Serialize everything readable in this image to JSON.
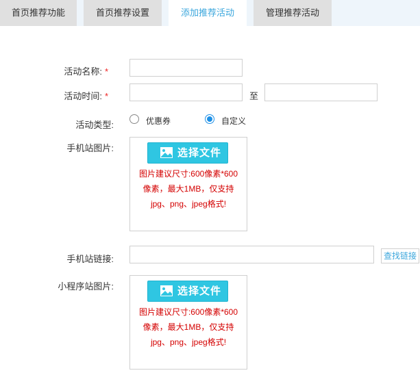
{
  "tabs": [
    {
      "label": "首页推荐功能",
      "active": false
    },
    {
      "label": "首页推荐设置",
      "active": false
    },
    {
      "label": "添加推荐活动",
      "active": true
    },
    {
      "label": "管理推荐活动",
      "active": false
    }
  ],
  "form": {
    "name": {
      "label": "活动名称:",
      "required": "*",
      "value": ""
    },
    "time": {
      "label": "活动时间:",
      "required": "*",
      "start_value": "",
      "separator": "至",
      "end_value": ""
    },
    "type": {
      "label": "活动类型:",
      "options": [
        {
          "label": "优惠券",
          "checked": false
        },
        {
          "label": "自定义",
          "checked": true
        }
      ]
    },
    "mobile_image": {
      "label": "手机站图片:",
      "button": "选择文件",
      "hint_lines": [
        "图片建议尺寸:600像素*600",
        "像素，最大1MB，仅支持",
        "jpg、png、jpeg格式!"
      ]
    },
    "mobile_link": {
      "label": "手机站链接:",
      "value": "",
      "button": "查找链接"
    },
    "miniapp_image": {
      "label": "小程序站图片:",
      "button": "选择文件",
      "hint_lines": [
        "图片建议尺寸:600像素*600",
        "像素，最大1MB，仅支持",
        "jpg、png、jpeg格式!"
      ]
    }
  },
  "colors": {
    "accent": "#3aa6dc",
    "required": "#e22222",
    "hint": "#d40000",
    "upload_button": "#2fc6e2"
  },
  "icons": {
    "upload": "image-upload-icon",
    "radio": "radio-icon"
  }
}
